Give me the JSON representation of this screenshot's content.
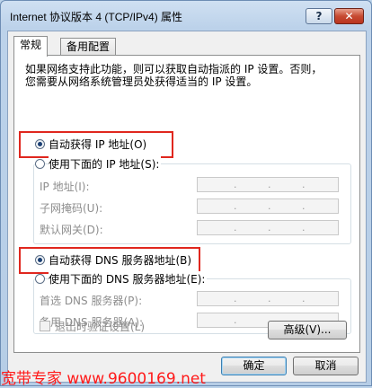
{
  "window": {
    "title": "Internet 协议版本 4 (TCP/IPv4) 属性",
    "help_label": "?",
    "close_label": "✕"
  },
  "tabs": [
    {
      "label": "常规",
      "active": true
    },
    {
      "label": "备用配置",
      "active": false
    }
  ],
  "general": {
    "description": "如果网络支持此功能，则可以获取自动指派的 IP 设置。否则，您需要从网络系统管理员处获得适当的 IP 设置。",
    "ip_section": {
      "auto_option": "自动获得 IP 地址(O)",
      "manual_option": "使用下面的 IP 地址(S):",
      "selected": "auto",
      "fields": [
        {
          "label": "IP 地址(I):",
          "value": ". . ."
        },
        {
          "label": "子网掩码(U):",
          "value": ". . ."
        },
        {
          "label": "默认网关(D):",
          "value": ". . ."
        }
      ]
    },
    "dns_section": {
      "auto_option": "自动获得 DNS 服务器地址(B)",
      "manual_option": "使用下面的 DNS 服务器地址(E):",
      "selected": "auto",
      "fields": [
        {
          "label": "首选 DNS 服务器(P):",
          "value": ". . ."
        },
        {
          "label": "备用 DNS 服务器(A):",
          "value": ". . ."
        }
      ]
    },
    "validate_on_exit_label": "退出时验证设置(L)",
    "advanced_button": "高级(V)..."
  },
  "footer": {
    "ok_button": "确定",
    "cancel_button": "取消"
  },
  "watermark": "宽带专家 www.9600169.net",
  "colors": {
    "highlight_box": "#e0271e",
    "watermark": "#ff1a1a",
    "title_bar": "#bcd3ea"
  }
}
